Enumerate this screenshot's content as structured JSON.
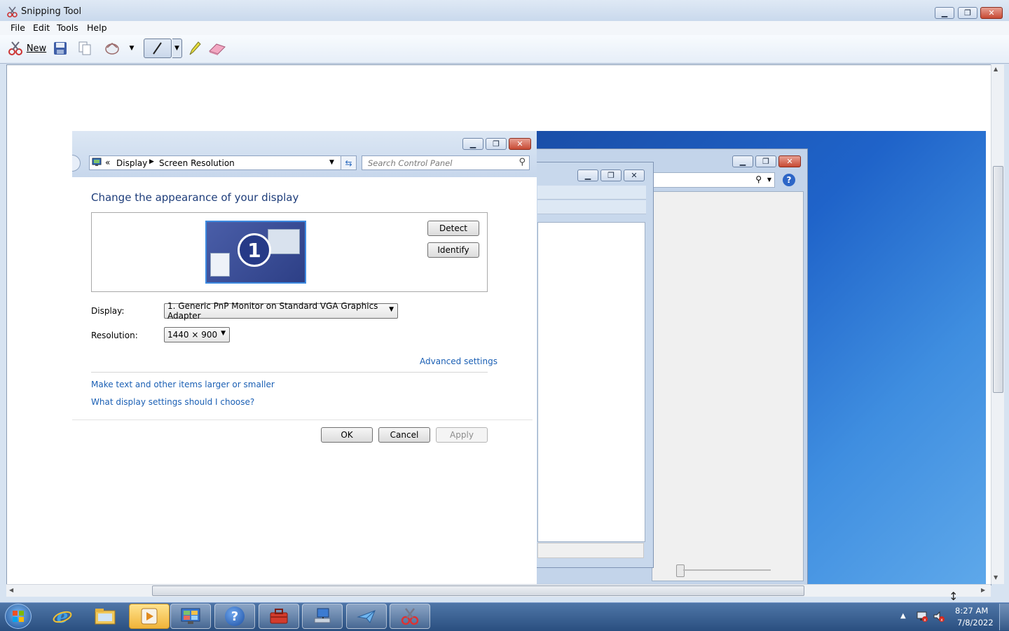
{
  "app": {
    "title": "Snipping Tool",
    "menu": [
      "File",
      "Edit",
      "Tools",
      "Help"
    ],
    "toolbar": {
      "new_label": "New"
    }
  },
  "dialog": {
    "breadcrumb": {
      "prefix": "«",
      "item1": "Display",
      "item2": "Screen Resolution"
    },
    "search_placeholder": "Search Control Panel",
    "heading": "Change the appearance of your display",
    "monitor_number": "1",
    "detect_label": "Detect",
    "identify_label": "Identify",
    "display_label": "Display:",
    "display_value": "1. Generic PnP Monitor on Standard VGA Graphics Adapter",
    "resolution_label": "Resolution:",
    "resolution_value": "1440 × 900",
    "advanced_link": "Advanced settings",
    "text_size_link": "Make text and other items larger or smaller",
    "help_link": "What display settings should I choose?",
    "ok_label": "OK",
    "cancel_label": "Cancel",
    "apply_label": "Apply"
  },
  "taskbar": {
    "time": "8:27 AM",
    "date": "7/8/2022"
  },
  "colors": {
    "link": "#1a5fb4",
    "heading": "#1e3d7a",
    "desktop": "#1f63c9",
    "taskbar": "#2a4f80"
  }
}
